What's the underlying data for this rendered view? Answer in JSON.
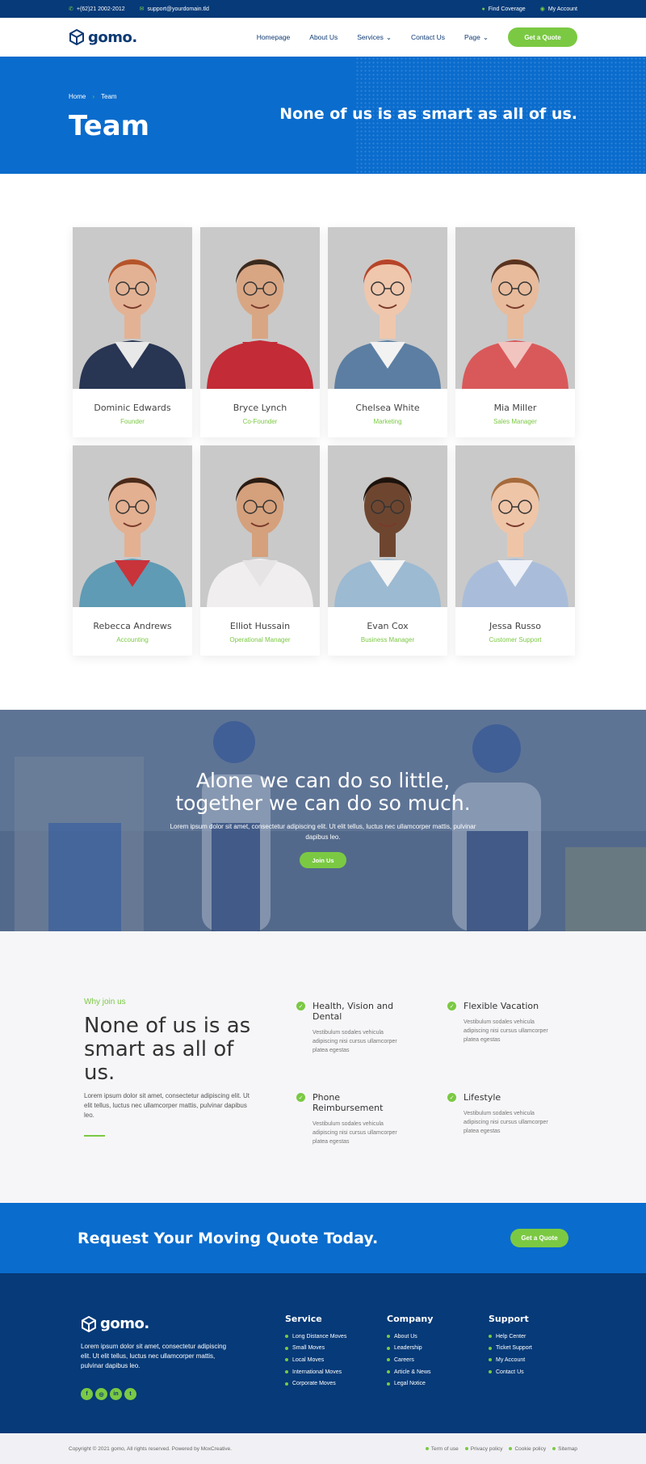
{
  "topbar": {
    "phone": "+(62)21 2002-2012",
    "email": "support@yourdomain.tld",
    "find_coverage": "Find Coverage",
    "my_account": "My Account"
  },
  "header": {
    "logo": "gomo.",
    "nav": [
      "Homepage",
      "About Us",
      "Services",
      "Contact Us",
      "Page"
    ],
    "quote_button": "Get a Quote"
  },
  "hero": {
    "breadcrumb_home": "Home",
    "breadcrumb_current": "Team",
    "title": "Team",
    "quote": "None of us is as smart as all of us."
  },
  "team": [
    {
      "name": "Dominic Edwards",
      "role": "Founder",
      "skin": "#e3b294",
      "hair": "#b4542a",
      "shirt": "#283553",
      "inner": "#e8e8e8"
    },
    {
      "name": "Bryce Lynch",
      "role": "Co-Founder",
      "skin": "#d9a684",
      "hair": "#3a2a1e",
      "shirt": "#c32b36",
      "inner": "#c32b36"
    },
    {
      "name": "Chelsea White",
      "role": "Marketing",
      "skin": "#efc7ad",
      "hair": "#b6442a",
      "shirt": "#5c7ea3",
      "inner": "#f2f2f2"
    },
    {
      "name": "Mia Miller",
      "role": "Sales Manager",
      "skin": "#e7bb9c",
      "hair": "#5a3320",
      "shirt": "#d9595a",
      "inner": "#f1c4c0"
    },
    {
      "name": "Rebecca Andrews",
      "role": "Accounting",
      "skin": "#e3b091",
      "hair": "#4a2a1a",
      "shirt": "#5f9bb4",
      "inner": "#c9333a"
    },
    {
      "name": "Elliot Hussain",
      "role": "Operational Manager",
      "skin": "#d5a07c",
      "hair": "#2b1c13",
      "shirt": "#f0eeee",
      "inner": "#e6e4e4"
    },
    {
      "name": "Evan Cox",
      "role": "Business Manager",
      "skin": "#6e4630",
      "hair": "#1c120c",
      "shirt": "#9cbad2",
      "inner": "#f4f4f4"
    },
    {
      "name": "Jessa Russo",
      "role": "Customer Support",
      "skin": "#efc5a8",
      "hair": "#a56a3c",
      "shirt": "#a9bddb",
      "inner": "#eef1f7"
    }
  ],
  "banner": {
    "line1": "Alone we can do so little,",
    "line2": "together we can do so much.",
    "text": "Lorem ipsum dolor sit amet, consectetur adipiscing elit. Ut elit tellus, luctus nec ullamcorper mattis, pulvinar dapibus leo.",
    "button": "Join Us"
  },
  "why": {
    "kicker": "Why join us",
    "title": "None of us is as smart as all of us.",
    "text": "Lorem ipsum dolor sit amet, consectetur adipiscing elit. Ut elit tellus, luctus nec ullamcorper mattis, pulvinar dapibus leo.",
    "features": [
      {
        "title": "Health, Vision and Dental",
        "desc": "Vestibulum sodales vehicula adipiscing nisi cursus ullamcorper platea egestas"
      },
      {
        "title": "Flexible Vacation",
        "desc": "Vestibulum sodales vehicula adipiscing nisi cursus ullamcorper platea egestas"
      },
      {
        "title": "Phone Reimbursement",
        "desc": "Vestibulum sodales vehicula adipiscing nisi cursus ullamcorper platea egestas"
      },
      {
        "title": "Lifestyle",
        "desc": "Vestibulum sodales vehicula adipiscing nisi cursus ullamcorper platea egestas"
      }
    ]
  },
  "cta": {
    "title": "Request Your Moving Quote Today.",
    "button": "Get a Quote"
  },
  "footer": {
    "logo": "gomo.",
    "desc": "Lorem ipsum dolor sit amet, consectetur adipiscing elit. Ut elit tellus, luctus nec ullamcorper mattis, pulvinar dapibus leo.",
    "service": {
      "title": "Service",
      "items": [
        "Long Distance Moves",
        "Small Moves",
        "Local Moves",
        "International Moves",
        "Corporate Moves"
      ]
    },
    "company": {
      "title": "Company",
      "items": [
        "About Us",
        "Leadership",
        "Careers",
        "Article & News",
        "Legal Notice"
      ]
    },
    "support": {
      "title": "Support",
      "items": [
        "Help Center",
        "Ticket Support",
        "My Account",
        "Contact Us"
      ]
    },
    "copyright": "Copyright © 2021 gomo, All rights reserved. Powered by MoxCreative.",
    "legal": [
      "Term of use",
      "Privacy policy",
      "Cookie policy",
      "Sitemap"
    ]
  },
  "colors": {
    "primary": "#0a6ccd",
    "dark": "#063a78",
    "accent": "#7bc943"
  },
  "icons": [
    "phone-icon",
    "email-icon",
    "location-icon",
    "user-icon",
    "chevron-down-icon",
    "check-icon",
    "facebook-icon",
    "instagram-icon",
    "linkedin-icon",
    "twitter-icon"
  ]
}
